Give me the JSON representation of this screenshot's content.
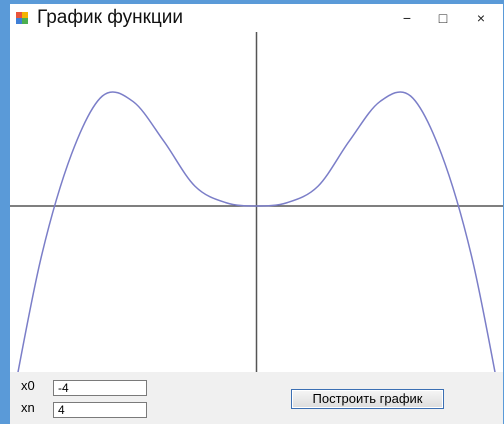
{
  "window": {
    "title": "График функции",
    "minimize_glyph": "−",
    "maximize_glyph": "□",
    "close_glyph": "×",
    "icons": [
      "app-icon",
      "minimize-icon",
      "maximize-icon",
      "close-icon"
    ]
  },
  "controls": {
    "x0_label": "x0",
    "x0_value": "-4",
    "xn_label": "xn",
    "xn_value": "4",
    "plot_button_label": "Построить график"
  },
  "colors": {
    "curve": "#7b7ec8",
    "axes": "#555555",
    "button_border": "#3b6fb3"
  },
  "chart_data": {
    "type": "line",
    "title": "",
    "xlabel": "",
    "ylabel": "",
    "grid": false,
    "xlim": [
      -4,
      4
    ],
    "series": [
      {
        "x": [
          -4,
          -3.5,
          -3,
          -2.5,
          -2,
          -1.5,
          -1,
          -0.5,
          0,
          0.5,
          1,
          1.5,
          2,
          2.5,
          3,
          3.5,
          4
        ],
        "y": [
          -16,
          -4.06,
          4,
          8.44,
          8,
          4.94,
          1.53,
          0.26,
          0,
          0.26,
          1.53,
          4.94,
          8,
          8.44,
          4,
          -4.06,
          -16
        ]
      }
    ]
  }
}
